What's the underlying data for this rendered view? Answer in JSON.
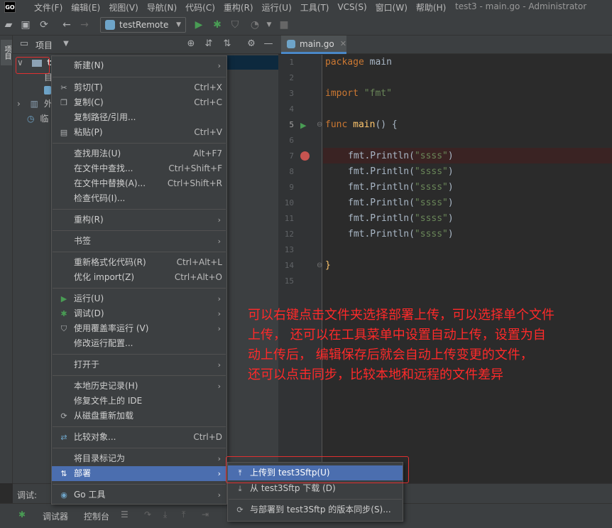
{
  "menubar": {
    "logo": "GO",
    "items": [
      "文件(F)",
      "编辑(E)",
      "视图(V)",
      "导航(N)",
      "代码(C)",
      "重构(R)",
      "运行(U)",
      "工具(T)",
      "VCS(S)",
      "窗口(W)",
      "帮助(H)"
    ],
    "title": "test3 - main.go - Administrator"
  },
  "toolbar": {
    "run_config": "testRemote"
  },
  "left_strip": {
    "tab": "项目"
  },
  "project_panel": {
    "title": "项目",
    "tree": {
      "root": "te",
      "child1": "目",
      "external": "外",
      "scratch": "临"
    }
  },
  "editor": {
    "tab": "main.go",
    "line_numbers": [
      "1",
      "2",
      "3",
      "4",
      "5",
      "6",
      "7",
      "8",
      "9",
      "10",
      "11",
      "12",
      "13",
      "14",
      "15"
    ],
    "code": {
      "l1_kw": "package",
      "l1_rest": " main",
      "l3_kw": "import",
      "l3_str": " \"fmt\"",
      "l5_kw": "func",
      "l5_fn": " main",
      "l5_rest": "() {",
      "println": "fmt.Println(",
      "str": "\"ssss\"",
      "close": ")",
      "l14": "}"
    }
  },
  "annotation": {
    "lines": [
      "可以右键点击文件夹选择部署上传，可以选择单个文件",
      "上传，  还可以在工具菜单中设置自动上传，设置为自",
      "动上传后，  编辑保存后就会自动上传变更的文件，",
      "还可以点击同步，比较本地和远程的文件差异"
    ]
  },
  "context_menu": {
    "new": "新建(N)",
    "cut": "剪切(T)",
    "cut_sc": "Ctrl+X",
    "copy": "复制(C)",
    "copy_sc": "Ctrl+C",
    "copy_path": "复制路径/引用...",
    "paste": "粘贴(P)",
    "paste_sc": "Ctrl+V",
    "find_usages": "查找用法(U)",
    "find_usages_sc": "Alt+F7",
    "find_in_files": "在文件中查找...",
    "find_in_files_sc": "Ctrl+Shift+F",
    "replace_in_files": "在文件中替换(A)...",
    "replace_in_files_sc": "Ctrl+Shift+R",
    "inspect": "检查代码(I)...",
    "refactor": "重构(R)",
    "bookmarks": "书签",
    "reformat": "重新格式化代码(R)",
    "reformat_sc": "Ctrl+Alt+L",
    "optimize": "优化 import(Z)",
    "optimize_sc": "Ctrl+Alt+O",
    "run": "运行(U)",
    "debug": "调试(D)",
    "coverage": "使用覆盖率运行 (V)",
    "modify_run": "修改运行配置...",
    "open_in": "打开于",
    "local_history": "本地历史记录(H)",
    "repair_ide": "修复文件上的 IDE",
    "reload": "从磁盘重新加载",
    "compare": "比较对象...",
    "compare_sc": "Ctrl+D",
    "mark_dir": "将目录标记为",
    "deploy": "部署",
    "go_tools": "Go 工具"
  },
  "submenu": {
    "upload": "上传到 test3Sftp(U)",
    "download": "从 test3Sftp 下载 (D)",
    "sync": "与部署到 test3Sftp 的版本同步(S)..."
  },
  "bottom": {
    "debug_label": "调试:",
    "tab_debugger": "调试器",
    "tab_console": "控制台"
  },
  "colors": {
    "accent": "#4b6eaf",
    "annotation": "#ff2a2a",
    "keyword": "#cc7832",
    "string": "#6a8759",
    "function": "#ffc66d",
    "run": "#499c54",
    "breakpoint": "#c75450"
  }
}
